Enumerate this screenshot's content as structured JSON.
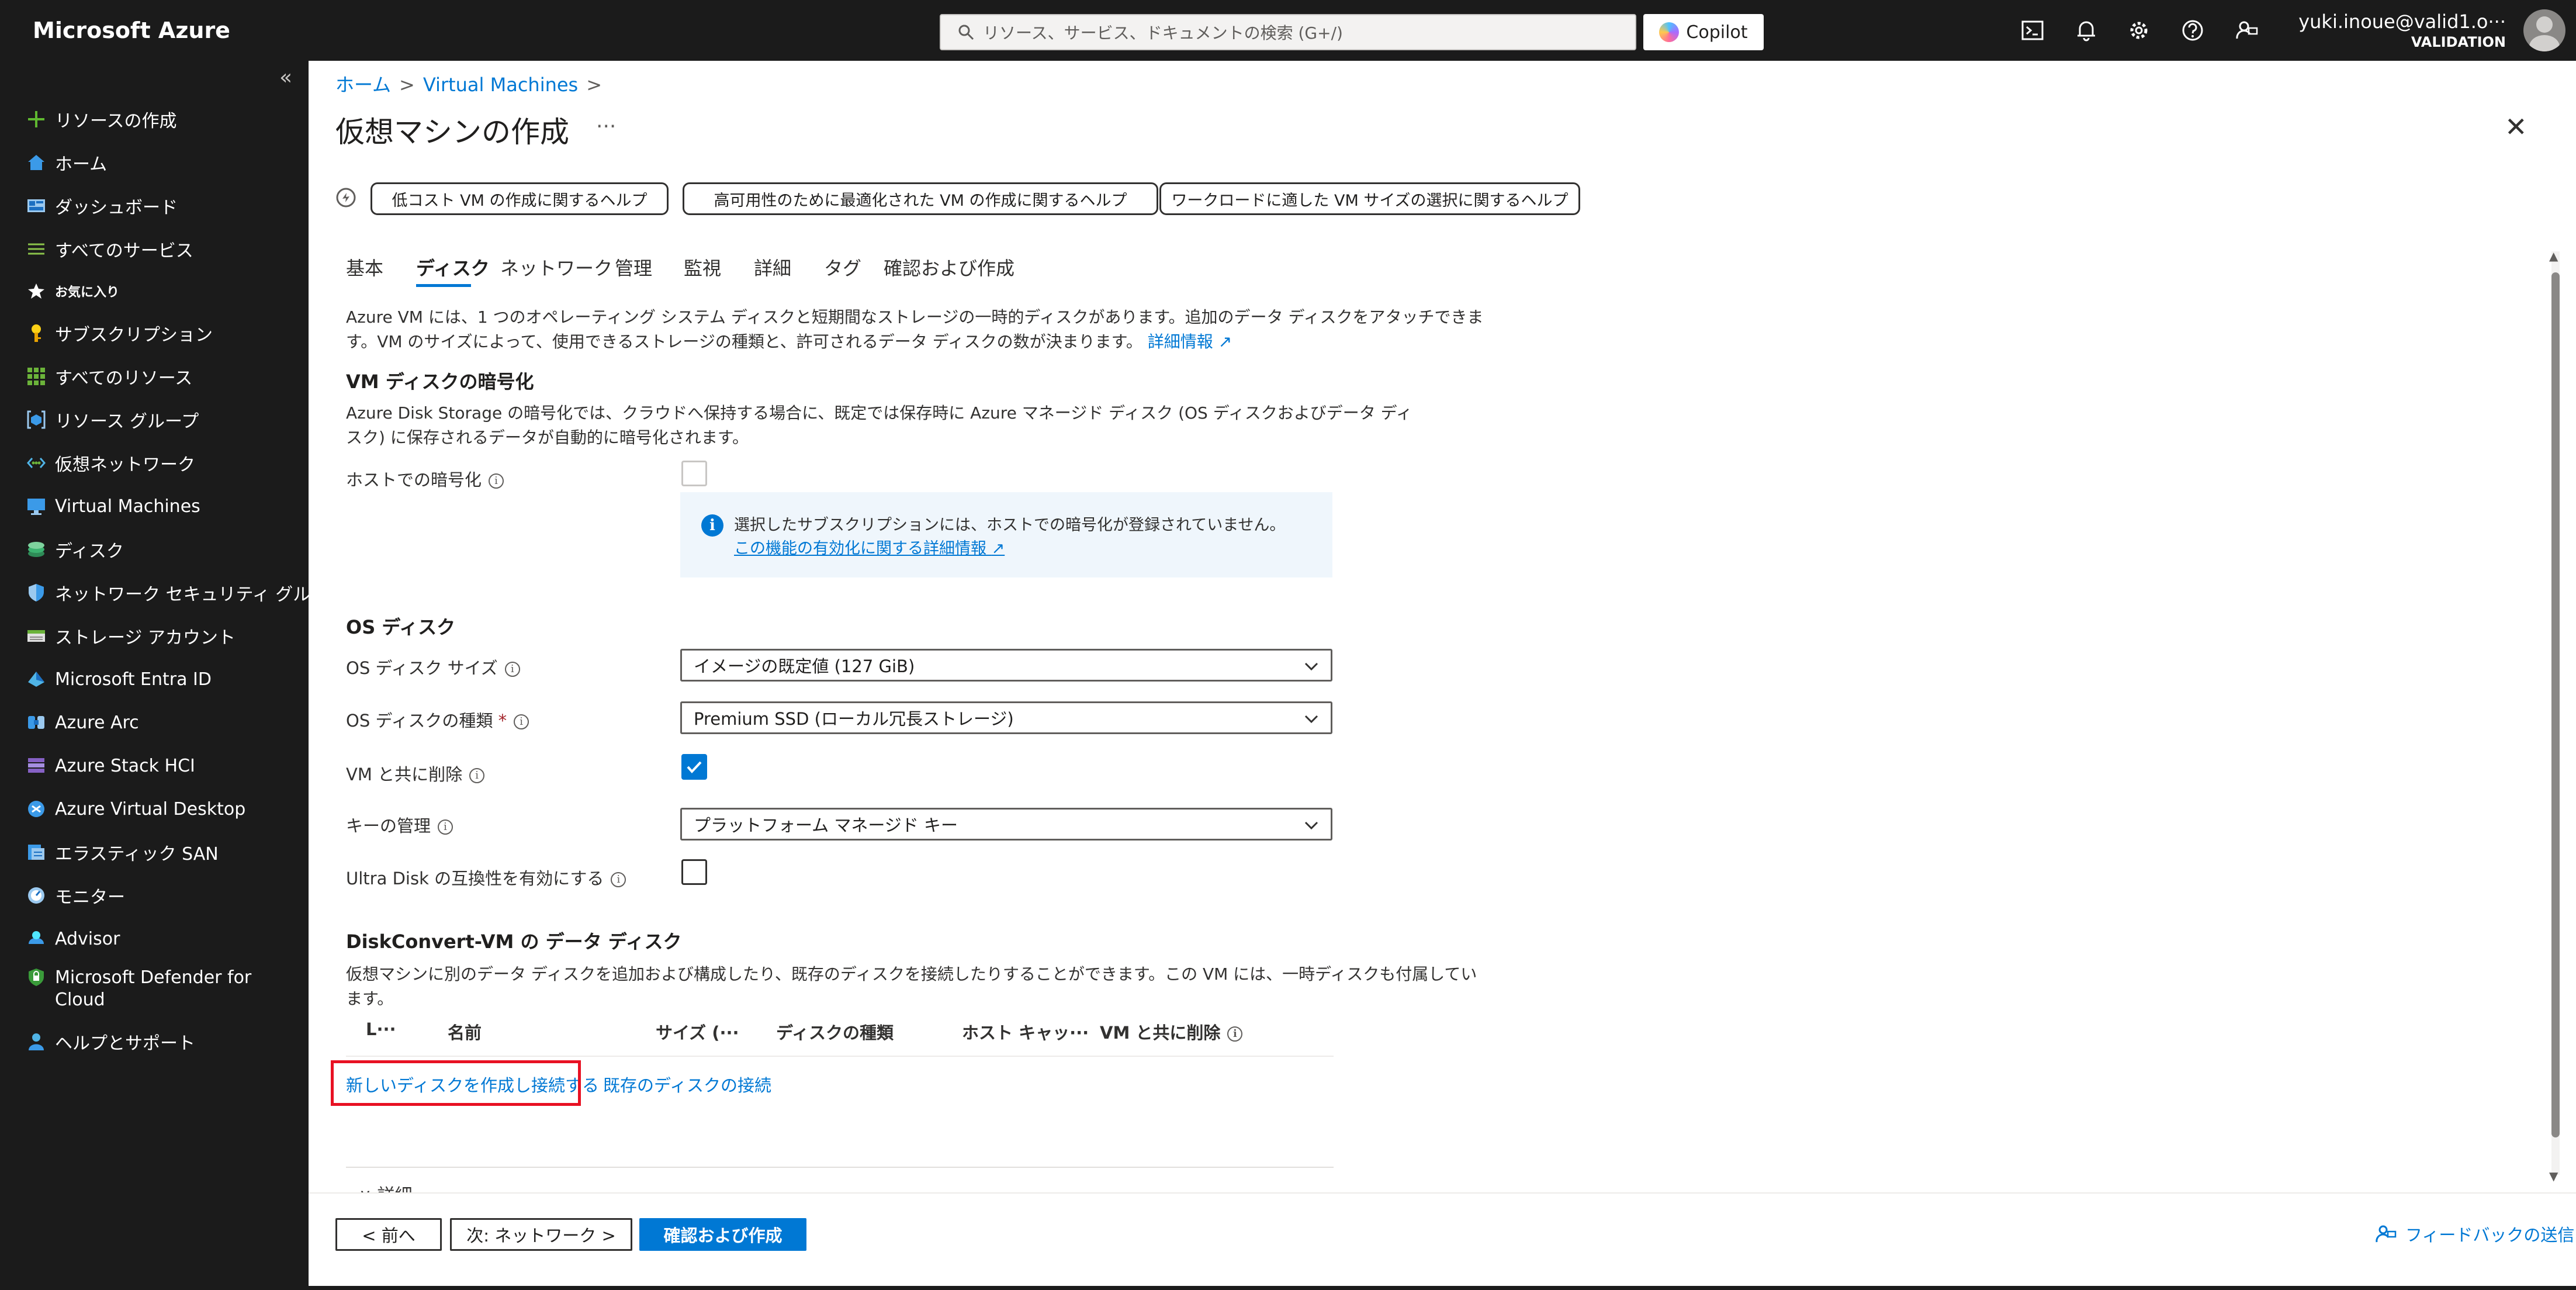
{
  "topbar": {
    "brand": "Microsoft Azure",
    "search_placeholder": "リソース、サービス、ドキュメントの検索 (G+/)",
    "copilot_label": "Copilot",
    "user_email": "yuki.inoue@valid1.o···",
    "user_tenant": "VALIDATION",
    "icons": [
      "cloud-shell-icon",
      "bell-icon",
      "gear-icon",
      "help-icon",
      "feedback-icon"
    ]
  },
  "sidebar": {
    "collapse_glyph": "«",
    "items": [
      {
        "label": "リソースの作成",
        "icon": "plus-icon"
      },
      {
        "label": "ホーム",
        "icon": "home-icon"
      },
      {
        "label": "ダッシュボード",
        "icon": "dashboard-icon"
      },
      {
        "label": "すべてのサービス",
        "icon": "list-icon"
      },
      {
        "label": "お気に入り",
        "icon": "star-icon"
      },
      {
        "label": "サブスクリプション",
        "icon": "key-icon"
      },
      {
        "label": "すべてのリソース",
        "icon": "grid-icon"
      },
      {
        "label": "リソース グループ",
        "icon": "resource-group-icon"
      },
      {
        "label": "仮想ネットワーク",
        "icon": "vnet-icon"
      },
      {
        "label": "Virtual Machines",
        "icon": "vm-icon"
      },
      {
        "label": "ディスク",
        "icon": "disk-icon"
      },
      {
        "label": "ネットワーク セキュリティ グループ",
        "icon": "shield-icon"
      },
      {
        "label": "ストレージ アカウント",
        "icon": "storage-icon"
      },
      {
        "label": "Microsoft Entra ID",
        "icon": "entra-icon"
      },
      {
        "label": "Azure Arc",
        "icon": "arc-icon"
      },
      {
        "label": "Azure Stack HCI",
        "icon": "stack-hci-icon"
      },
      {
        "label": "Azure Virtual Desktop",
        "icon": "virtual-desktop-icon"
      },
      {
        "label": "エラスティック SAN",
        "icon": "elastic-san-icon"
      },
      {
        "label": "モニター",
        "icon": "monitor-icon"
      },
      {
        "label": "Advisor",
        "icon": "advisor-icon"
      },
      {
        "label": "Microsoft Defender for",
        "label2": "Cloud",
        "icon": "defender-icon"
      },
      {
        "label": "ヘルプとサポート",
        "icon": "support-icon"
      }
    ]
  },
  "breadcrumb": {
    "home": "ホーム",
    "vm": "Virtual Machines",
    "sep": ">"
  },
  "page": {
    "title": "仮想マシンの作成",
    "more": "···",
    "close": "✕"
  },
  "help_buttons": [
    "低コスト VM の作成に関するヘルプ",
    "高可用性のために最適化された VM の作成に関するヘルプ",
    "ワークロードに適した VM サイズの選択に関するヘルプ"
  ],
  "tabs": [
    "基本",
    "ディスク",
    "ネットワーク",
    "管理",
    "監視",
    "詳細",
    "タグ",
    "確認および作成"
  ],
  "intro": {
    "line1": "Azure VM には、1 つのオペレーティング システム ディスクと短期間なストレージの一時的ディスクがあります。追加のデータ ディスクをアタッチできま",
    "line2": "す。VM のサイズによって、使用できるストレージの種類と、許可されるデータ ディスクの数が決まります。",
    "link": "詳細情報"
  },
  "encryption": {
    "heading": "VM ディスクの暗号化",
    "line1": "Azure Disk Storage の暗号化では、クラウドへ保持する場合に、既定では保存時に Azure マネージド ディスク (OS ディスクおよびデータ ディ",
    "line2": "スク) に保存されるデータが自動的に暗号化されます。",
    "host_label": "ホストでの暗号化",
    "info_text": "選択したサブスクリプションには、ホストでの暗号化が登録されていません。",
    "info_link": "この機能の有効化に関する詳細情報"
  },
  "os_disk": {
    "heading": "OS ディスク",
    "size_label": "OS ディスク サイズ",
    "size_value": "イメージの既定値 (127 GiB)",
    "type_label": "OS ディスクの種類",
    "required": "*",
    "type_value": "Premium SSD (ローカル冗長ストレージ)",
    "delete_label": "VM と共に削除",
    "key_label": "キーの管理",
    "key_value": "プラットフォーム マネージド キー",
    "ultra_label": "Ultra Disk の互換性を有効にする"
  },
  "data_disks": {
    "heading": "DiskConvert-VM の データ ディスク",
    "line1": "仮想マシンに別のデータ ディスクを追加および構成したり、既存のディスクを接続したりすることができます。この VM には、一時ディスクも付属してい",
    "line2": "ます。",
    "columns": [
      "L···",
      "名前",
      "サイズ (···",
      "ディスクの種類",
      "ホスト キャッ···",
      "VM と共に削除"
    ],
    "create_link": "新しいディスクを作成し接続する",
    "attach_link": "既存のディスクの接続",
    "details_label": "詳細"
  },
  "footer": {
    "prev": "< 前へ",
    "next": "次: ネットワーク >",
    "review": "確認および作成",
    "feedback": "フィードバックの送信"
  }
}
